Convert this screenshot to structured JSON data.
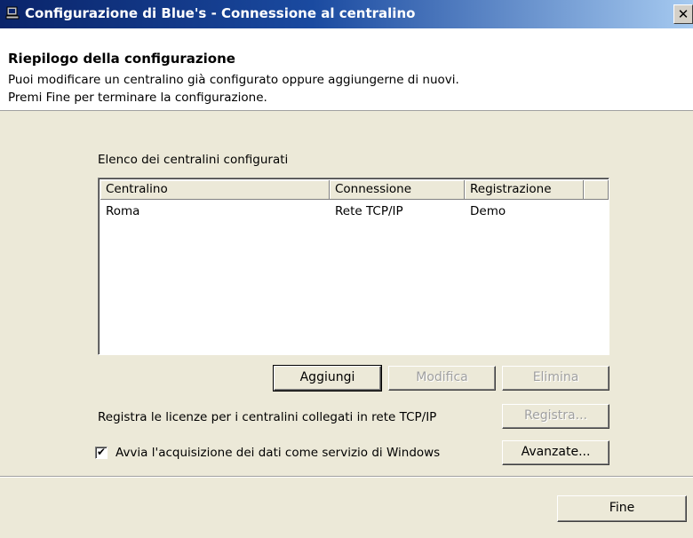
{
  "window": {
    "title": "Configurazione di Blue's - Connessione al centralino",
    "close_glyph": "✕"
  },
  "header": {
    "title": "Riepilogo della configurazione",
    "line1": "Puoi modificare un centralino già configurato oppure aggiungerne di nuovi.",
    "line2": "Premi Fine per terminare la configurazione."
  },
  "list": {
    "label": "Elenco dei centralini configurati",
    "columns": [
      "Centralino",
      "Connessione",
      "Registrazione",
      ""
    ],
    "rows": [
      {
        "name": "Roma",
        "connection": "Rete TCP/IP",
        "registration": "Demo"
      }
    ]
  },
  "buttons": {
    "add": "Aggiungi",
    "edit": "Modifica",
    "delete": "Elimina",
    "register": "Registra...",
    "advanced": "Avanzate...",
    "finish": "Fine"
  },
  "register_label": "Registra le licenze per i centralini collegati in rete TCP/IP",
  "service_checkbox": {
    "label": "Avvia l'acquisizione dei dati come servizio di Windows",
    "checked": true,
    "mark": "✔"
  }
}
